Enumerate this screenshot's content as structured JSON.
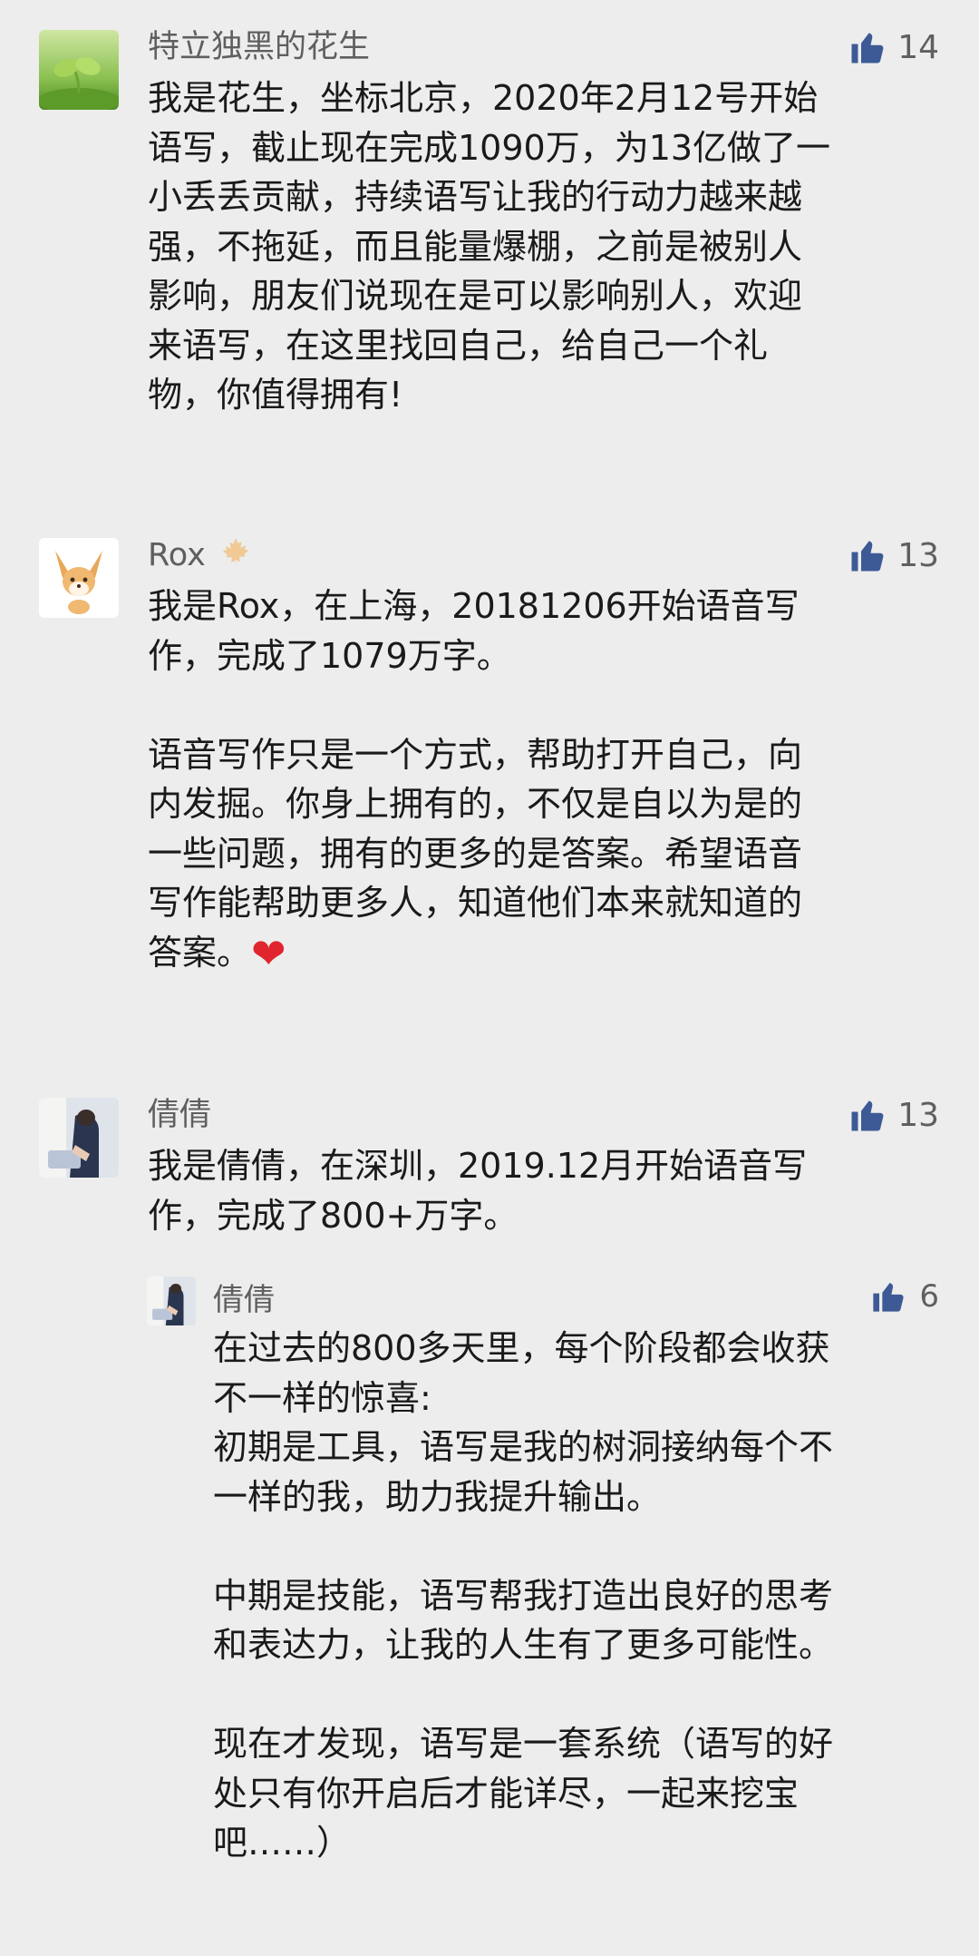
{
  "comments": [
    {
      "author": "特立独黑的花生",
      "likes": "14",
      "avatar_icon": "sprout-avatar",
      "lines": [
        "我是花生，坐标北京，2020年2月12号开始",
        "语写，截止现在完成1090万，为13亿做了一",
        "小丢丢贡献，持续语写让我的行动力越来越",
        "强，不拖延，而且能量爆棚，之前是被别人",
        "影响，朋友们说现在是可以影响别人，欢迎",
        "来语写，在这里找回自己，给自己一个礼",
        "物，你值得拥有!"
      ]
    },
    {
      "author": "Rox",
      "badge_icon": "maple-leaf-icon",
      "likes": "13",
      "avatar_icon": "fox-avatar",
      "lines": [
        "我是Rox，在上海，20181206开始语音写",
        "作，完成了1079万字。",
        "",
        "语音写作只是一个方式，帮助打开自己，向",
        "内发掘。你身上拥有的，不仅是自以为是的",
        "一些问题，拥有的更多的是答案。希望语音",
        "写作能帮助更多人，知道他们本来就知道的",
        "答案。"
      ],
      "trailing_emoji": "❤"
    },
    {
      "author": "倩倩",
      "likes": "13",
      "avatar_icon": "person-photo-avatar",
      "lines": [
        "我是倩倩，在深圳，2019.12月开始语音写",
        "作，完成了800+万字。"
      ],
      "reply": {
        "author": "倩倩",
        "likes": "6",
        "lines": [
          "在过去的800多天里，每个阶段都会收获",
          "不一样的惊喜:",
          "初期是工具，语写是我的树洞接纳每个不",
          "一样的我，助力我提升输出。",
          "",
          "中期是技能，语写帮我打造出良好的思考",
          "和表达力，让我的人生有了更多可能性。",
          "",
          "现在才发现，语写是一套系统（语写的好",
          "处只有你开启后才能详尽，一起来挖宝",
          "吧……）"
        ]
      }
    }
  ],
  "colors": {
    "background": "#ededed",
    "name_gray": "#5f5f5f",
    "like_blue": "#3d5a96",
    "heart_red": "#e0252e"
  }
}
